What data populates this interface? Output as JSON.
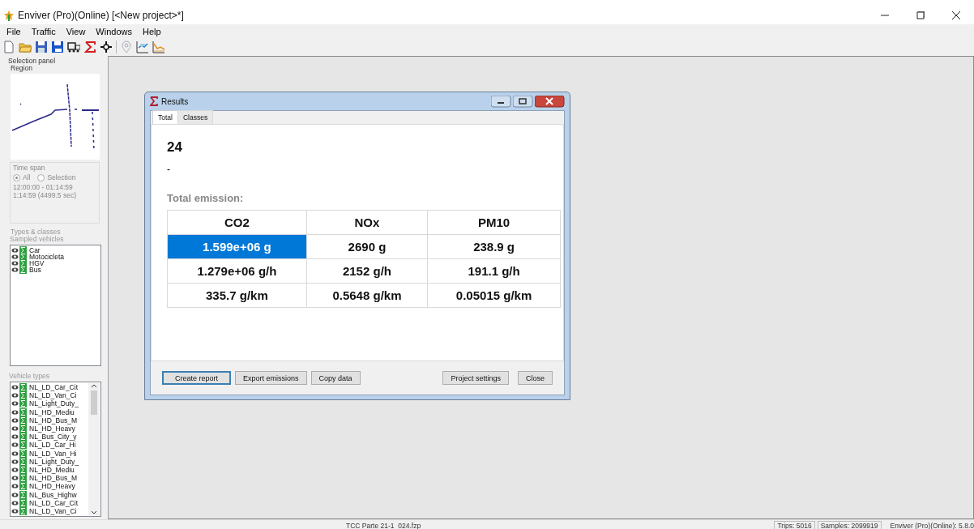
{
  "window": {
    "title": "Enviver (Pro)(Online) [<New project>*]"
  },
  "menu": [
    "File",
    "Traffic",
    "View",
    "Windows",
    "Help"
  ],
  "selection_panel": {
    "title": "Selection panel",
    "region_label": "Region",
    "time_span": {
      "label": "Time span",
      "options": [
        {
          "label": "All",
          "selected": true
        },
        {
          "label": "Selection",
          "selected": false
        }
      ],
      "range": "12:00:00 - 01:14:59",
      "duration": "1:14:59 (4499.5 sec)"
    },
    "types_classes": {
      "label": "Types & classes",
      "sampled_label": "Sampled vehicles",
      "items": [
        "Car",
        "Motocicleta",
        "HGV",
        "Bus"
      ]
    },
    "vehicle_types": {
      "label": "Vehicle types",
      "items": [
        "NL_LD_Car_Cit",
        "NL_LD_Van_Ci",
        "NL_Light_Duty_",
        "NL_HD_Mediu",
        "NL_HD_Bus_M",
        "NL_HD_Heavy",
        "NL_Bus_City_y",
        "NL_LD_Car_Hi",
        "NL_LD_Van_Hi",
        "NL_Light_Duty_",
        "NL_HD_Mediu",
        "NL_HD_Bus_M",
        "NL_HD_Heavy",
        "NL_Bus_Highw",
        "NL_LD_Car_Cit",
        "NL_LD_Van_Ci"
      ]
    }
  },
  "results_dialog": {
    "title": "Results",
    "tabs": [
      {
        "label": "Total",
        "selected": true
      },
      {
        "label": "Classes",
        "selected": false
      }
    ],
    "count": "24",
    "subtitle": "-",
    "section_label": "Total emission:",
    "columns": [
      "CO2",
      "NOx",
      "PM10"
    ],
    "rows": [
      [
        {
          "text": "1.599e+06 g",
          "selected": true
        },
        {
          "text": "2690 g",
          "selected": false
        },
        {
          "text": "238.9 g",
          "selected": false
        }
      ],
      [
        {
          "text": "1.279e+06 g/h",
          "selected": false
        },
        {
          "text": "2152 g/h",
          "selected": false
        },
        {
          "text": "191.1 g/h",
          "selected": false
        }
      ],
      [
        {
          "text": "335.7 g/km",
          "selected": false
        },
        {
          "text": "0.5648 g/km",
          "selected": false
        },
        {
          "text": "0.05015 g/km",
          "selected": false
        }
      ]
    ],
    "buttons": [
      {
        "label": "Create report",
        "default": true
      },
      {
        "label": "Export emissions",
        "default": false
      },
      {
        "label": "Copy data",
        "default": false
      },
      {
        "label": "Project settings",
        "default": false
      },
      {
        "label": "Close",
        "default": false
      }
    ]
  },
  "status_bar": {
    "file": "TCC Parte 21-1_024.fzp",
    "trips": "Trips: 5016",
    "samples": "Samples: 2099919",
    "version": "Enviver (Pro)(Online): 5.8.0"
  }
}
